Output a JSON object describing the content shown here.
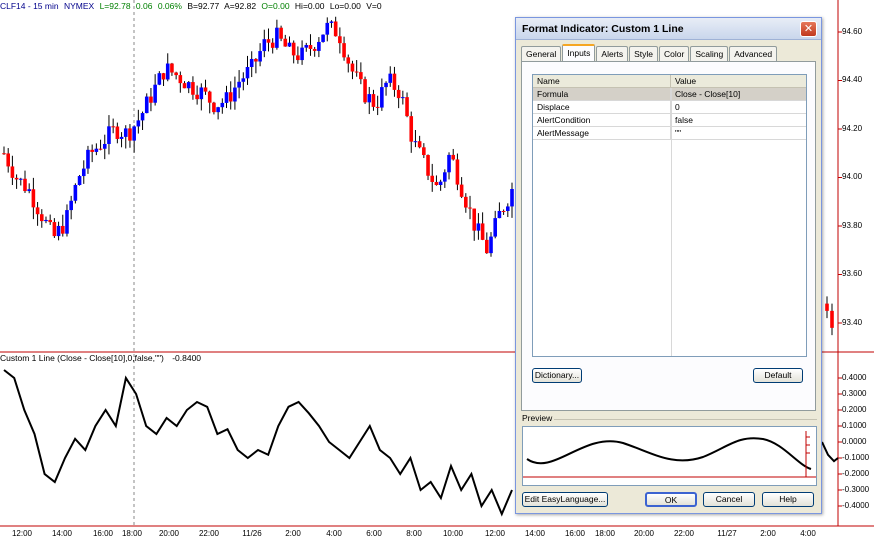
{
  "info_bar": {
    "symbol": "CLF14 - 15 min",
    "exchange": "NYMEX",
    "last": "L=92.78",
    "change": "0.06",
    "change_pct": "0.06%",
    "bid": "B=92.77",
    "ask": "A=92.82",
    "open": "O=0.00",
    "high": "Hi=0.00",
    "low": "Lo=0.00",
    "volume": "V=0"
  },
  "indicator_label": {
    "name": "Custom 1 Line (Close - Close[10],0,false,\"\")",
    "value": "-0.8400"
  },
  "price_axis": [
    "94.60",
    "94.40",
    "94.20",
    "94.00",
    "93.80",
    "93.60",
    "93.40"
  ],
  "indicator_axis": [
    "0.4000",
    "0.3000",
    "0.2000",
    "0.1000",
    "0.0000",
    "-0.1000",
    "-0.2000",
    "-0.3000",
    "-0.4000"
  ],
  "time_axis": [
    "12:00",
    "14:00",
    "16:00",
    "18:00",
    "20:00",
    "22:00",
    "11/26",
    "2:00",
    "4:00",
    "6:00",
    "8:00",
    "10:00",
    "12:00",
    "14:00",
    "16:00",
    "18:00",
    "20:00",
    "22:00",
    "11/27",
    "2:00",
    "4:00"
  ],
  "colors": {
    "up_candle": "#0000ff",
    "down_candle": "#ff0000",
    "indicator_line": "#000000",
    "separator": "#c00000"
  },
  "chart_data": [
    {
      "type": "candlestick",
      "title": "CLF14 - 15 min",
      "ylim": [
        93.2,
        94.75
      ],
      "y_ticks": [
        93.4,
        93.6,
        93.8,
        94.0,
        94.2,
        94.4,
        94.6
      ],
      "x_ticks": [
        "12:00",
        "14:00",
        "16:00",
        "18:00",
        "20:00",
        "22:00",
        "11/26",
        "2:00",
        "4:00",
        "6:00",
        "8:00",
        "10:00",
        "12:00",
        "14:00",
        "16:00",
        "18:00",
        "20:00",
        "22:00",
        "11/27",
        "2:00",
        "4:00"
      ],
      "approx_close_path": [
        94.1,
        94.0,
        93.95,
        93.85,
        93.75,
        93.82,
        94.0,
        94.1,
        94.15,
        94.2,
        94.18,
        94.25,
        94.35,
        94.45,
        94.42,
        94.38,
        94.35,
        94.3,
        94.32,
        94.4,
        94.45,
        94.55,
        94.58,
        94.52,
        94.5,
        94.55,
        94.62,
        94.6,
        94.45,
        94.35,
        94.3,
        94.4,
        94.35,
        94.15,
        94.05,
        93.95,
        94.1,
        93.95,
        93.8,
        93.7,
        93.85,
        93.95
      ],
      "last_visible": [
        93.45,
        93.38
      ]
    },
    {
      "type": "line",
      "title": "Custom 1 Line (Close - Close[10],0,false,\"\")",
      "ylim": [
        -0.45,
        0.45
      ],
      "y_ticks": [
        -0.4,
        -0.3,
        -0.2,
        -0.1,
        0.0,
        0.1,
        0.2,
        0.3,
        0.4
      ],
      "approx_values": [
        0.45,
        0.4,
        0.2,
        0.05,
        -0.2,
        -0.25,
        -0.1,
        0.02,
        -0.05,
        0.1,
        0.2,
        0.1,
        0.4,
        0.3,
        0.1,
        0.05,
        0.15,
        0.1,
        0.2,
        0.25,
        0.22,
        0.05,
        0.08,
        -0.05,
        -0.1,
        -0.05,
        -0.08,
        0.1,
        0.22,
        0.25,
        0.18,
        0.1,
        0.0,
        -0.05,
        -0.1,
        0.0,
        0.1,
        -0.05,
        -0.1,
        -0.2,
        -0.1,
        -0.3,
        -0.25,
        -0.35,
        -0.15,
        -0.3,
        -0.2,
        -0.4,
        -0.3,
        -0.45,
        -0.3
      ],
      "last_value": -0.84
    }
  ],
  "dialog": {
    "title": "Format Indicator: Custom 1 Line",
    "close_glyph": "✕",
    "tabs": [
      "General",
      "Inputs",
      "Alerts",
      "Style",
      "Color",
      "Scaling",
      "Advanced"
    ],
    "active_tab": "Inputs",
    "grid": {
      "headers": {
        "name": "Name",
        "value": "Value"
      },
      "rows": [
        {
          "name": "Formula",
          "value": "Close - Close[10]",
          "selected": true
        },
        {
          "name": "Displace",
          "value": "0",
          "selected": false
        },
        {
          "name": "AlertCondition",
          "value": "false",
          "selected": false
        },
        {
          "name": "AlertMessage",
          "value": "\"\"",
          "selected": false
        }
      ]
    },
    "dictionary_button": "Dictionary...",
    "default_button": "Default",
    "preview_label": "Preview",
    "edit_button": "Edit EasyLanguage...",
    "ok_button": "OK",
    "cancel_button": "Cancel",
    "help_button": "Help"
  }
}
